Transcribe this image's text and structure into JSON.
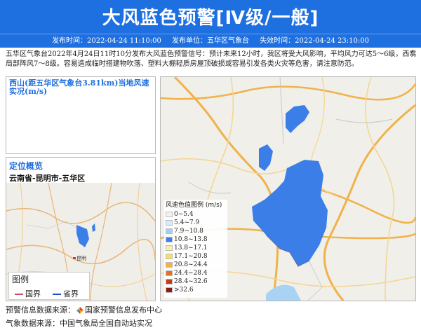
{
  "header": {
    "title": "大风蓝色预警[Ⅳ级/一般]",
    "publish_time": "发布时间：2022-04-24 11:10:00",
    "publisher": "发布单位：五华区气象台",
    "expire_time": "失效时间：2022-04-24 23:10:00"
  },
  "description": "五华区气象台2022年4月24日11时10分发布大风蓝色预警信号：预计未来12小时，我区将受大风影响，平均风力可达5～6级，西翥局部阵风7～8级。容易造成临时搭建物吹落、塑料大棚轻质房屋顶破损或容易引发各类火灾等危害，请注意防范。",
  "wind_panel": {
    "title": "西山(距五华区气象台3.81km)当地风速实况(m/s)"
  },
  "location": {
    "title": "定位概览",
    "subtitle": "云南省-昆明市-五华区",
    "map_label": "昆明"
  },
  "legend_small": {
    "title": "图例",
    "items": [
      {
        "label": "国界",
        "color": "#c0506a"
      },
      {
        "label": "省界",
        "color": "#1e4fd0"
      }
    ]
  },
  "wind_legend": {
    "title": "风速色值图例 (m/s)",
    "items": [
      {
        "label": "0~5.4",
        "color": "#f2f2f2"
      },
      {
        "label": "5.4~7.9",
        "color": "#d6ecfb"
      },
      {
        "label": "7.9~10.8",
        "color": "#9fd0f5"
      },
      {
        "label": "10.8~13.8",
        "color": "#3b7ee8"
      },
      {
        "label": "13.8~17.1",
        "color": "#f7f3a6"
      },
      {
        "label": "17.1~20.8",
        "color": "#f3e06a"
      },
      {
        "label": "20.8~24.4",
        "color": "#f3b23c"
      },
      {
        "label": "24.4~28.4",
        "color": "#e3721f"
      },
      {
        "label": "28.4~32.6",
        "color": "#c73a16"
      },
      {
        "label": ">32.6",
        "color": "#8e1a0c"
      }
    ]
  },
  "footer": {
    "warn_source_label": "预警信息数据来源：",
    "warn_source_value": "国家预警信息发布中心",
    "weather_source_label": "气象数据来源：",
    "weather_source_value": "中国气象局全国自动站实况"
  },
  "colors": {
    "brand_blue": "#1e6fe0",
    "warning_area": "#3b7ee8"
  }
}
